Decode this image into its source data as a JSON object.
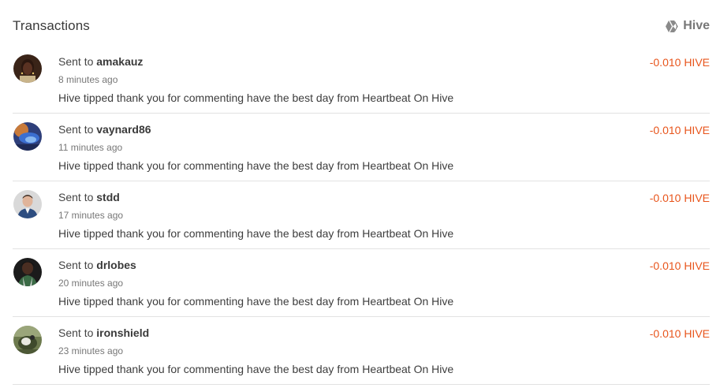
{
  "header": {
    "title": "Transactions",
    "brand_label": "Hive",
    "brand_icon": "hive-logo-icon"
  },
  "colors": {
    "amount": "#e8551c",
    "divider": "#e2e2e2",
    "brand": "#777777"
  },
  "transactions": [
    {
      "prefix": "Sent to",
      "user": "amakauz",
      "time": "8 minutes ago",
      "memo": "Hive tipped thank you for commenting have the best day from Heartbeat On Hive",
      "amount": "-0.010 HIVE"
    },
    {
      "prefix": "Sent to",
      "user": "vaynard86",
      "time": "11 minutes ago",
      "memo": "Hive tipped thank you for commenting have the best day from Heartbeat On Hive",
      "amount": "-0.010 HIVE"
    },
    {
      "prefix": "Sent to",
      "user": "stdd",
      "time": "17 minutes ago",
      "memo": "Hive tipped thank you for commenting have the best day from Heartbeat On Hive",
      "amount": "-0.010 HIVE"
    },
    {
      "prefix": "Sent to",
      "user": "drlobes",
      "time": "20 minutes ago",
      "memo": "Hive tipped thank you for commenting have the best day from Heartbeat On Hive",
      "amount": "-0.010 HIVE"
    },
    {
      "prefix": "Sent to",
      "user": "ironshield",
      "time": "23 minutes ago",
      "memo": "Hive tipped thank you for commenting have the best day from Heartbeat On Hive",
      "amount": "-0.010 HIVE"
    }
  ]
}
